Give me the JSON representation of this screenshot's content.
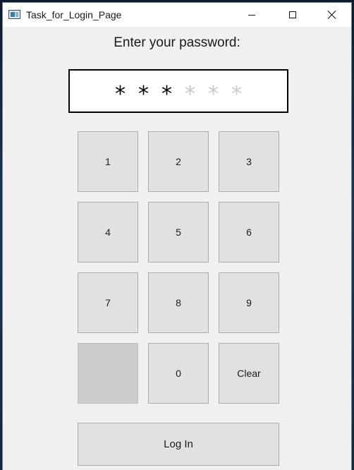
{
  "window": {
    "title": "Task_for_Login_Page"
  },
  "prompt": "Enter your password:",
  "pin": {
    "length": 6,
    "filled_count": 3,
    "filled_char": "*",
    "empty_char": "*",
    "chars": [
      "*",
      "*",
      "*",
      "*",
      "*",
      "*"
    ]
  },
  "keypad": {
    "k1": "1",
    "k2": "2",
    "k3": "3",
    "k4": "4",
    "k5": "5",
    "k6": "6",
    "k7": "7",
    "k8": "8",
    "k9": "9",
    "k0": "0",
    "clear": "Clear"
  },
  "login_label": "Log In",
  "icons": {
    "app": "app-window-icon",
    "minimize": "minimize-icon",
    "maximize": "maximize-icon",
    "close": "close-icon"
  },
  "colors": {
    "window_bg": "#f0f0f0",
    "button_bg": "#e1e1e1",
    "disabled_key_bg": "#cccccc",
    "pin_filled": "#000000",
    "pin_empty": "#c8c8c8"
  }
}
